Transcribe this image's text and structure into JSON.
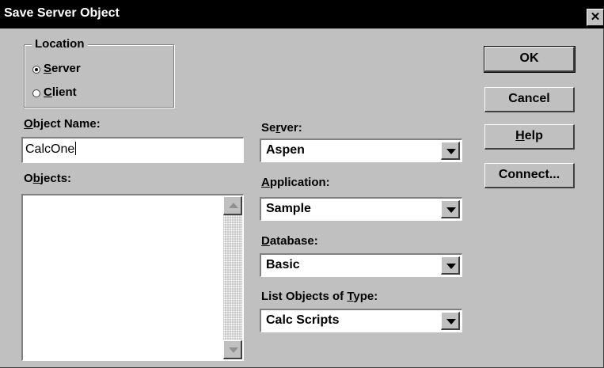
{
  "dialog": {
    "title": "Save Server Object"
  },
  "location": {
    "legend": "Location",
    "server_label": "Server",
    "server_key": "S",
    "server_rest": "erver",
    "client_label": "Client",
    "client_key": "C",
    "client_rest": "lient",
    "selected": "Server"
  },
  "object_name": {
    "label_key": "O",
    "label_rest": "bject Name:",
    "value": "CalcOne"
  },
  "objects": {
    "label_pre": "O",
    "label_key": "b",
    "label_rest": "jects:",
    "items": []
  },
  "server": {
    "label_pre": "Se",
    "label_key": "r",
    "label_rest": "ver:",
    "value": "Aspen"
  },
  "application": {
    "label_key": "A",
    "label_rest": "pplication:",
    "value": "Sample"
  },
  "database": {
    "label_key": "D",
    "label_rest": "atabase:",
    "value": "Basic"
  },
  "list_type": {
    "label_pre": "List Objects of ",
    "label_key": "T",
    "label_rest": "ype:",
    "value": "Calc Scripts"
  },
  "buttons": {
    "ok": "OK",
    "cancel": "Cancel",
    "help_key": "H",
    "help_rest": "elp",
    "connect": "Connect..."
  }
}
